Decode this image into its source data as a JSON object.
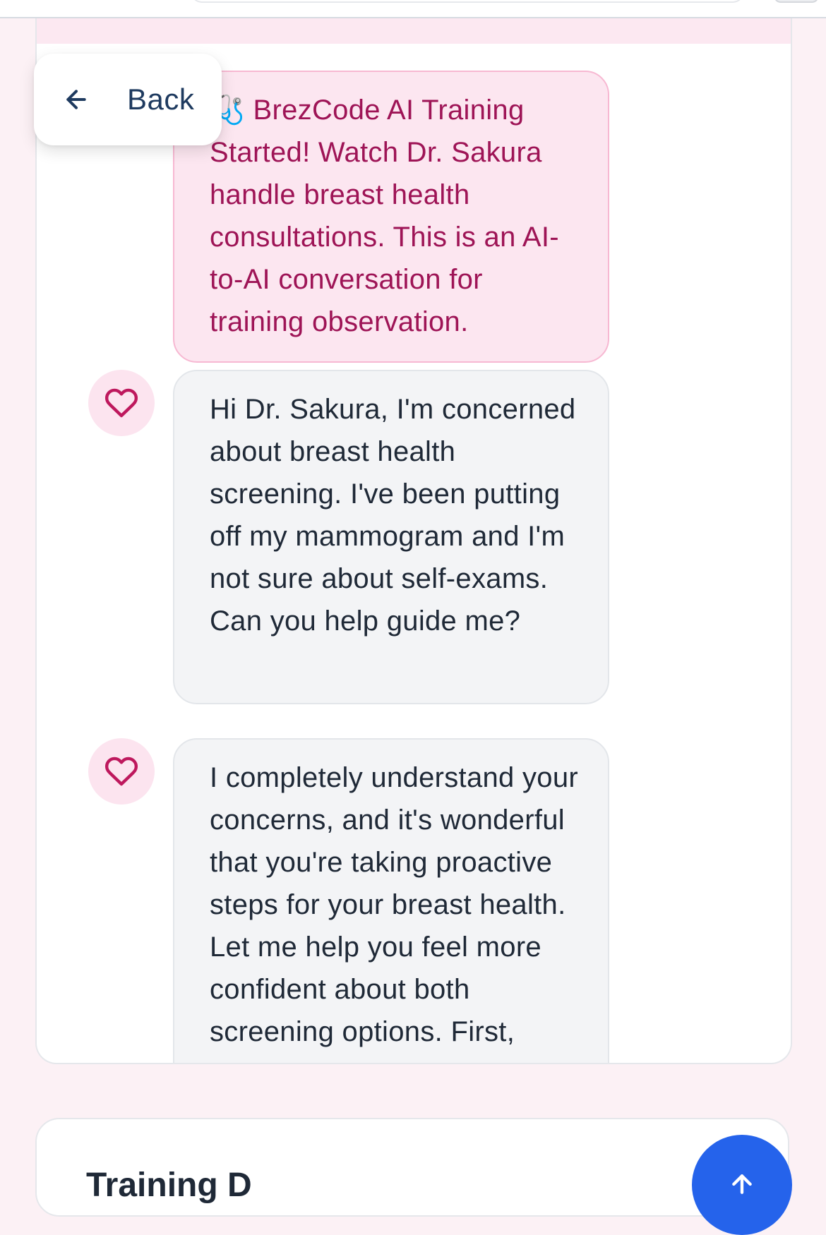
{
  "back_button": {
    "label": "Back",
    "icon": "arrow-left-icon"
  },
  "messages": [
    {
      "role": "system",
      "icon": "stethoscope-icon",
      "icon_glyph": "🩺",
      "text": "BrezCode AI Training Started! Watch Dr. Sakura handle breast health consultations. This is an AI-to-AI conversation for training observation."
    },
    {
      "role": "patient",
      "icon": "heart-icon",
      "text": "Hi Dr. Sakura, I'm concerned about breast health screening. I've been putting off my mammogram and I'm not sure about self-exams. Can you help guide me?"
    },
    {
      "role": "doctor",
      "icon": "heart-icon",
      "text": "I completely understand your concerns, and it's wonderful that you're taking proactive steps for your breast health. Let me help you feel more confident about both screening options. First, regarding mammograms"
    }
  ],
  "training_panel": {
    "title": "Training D"
  },
  "fab": {
    "icon": "arrow-up-icon"
  },
  "colors": {
    "page_bg": "#fcf1f5",
    "system_bubble_bg": "#fce6f0",
    "system_text": "#9e1456",
    "ai_bubble_bg": "#f3f4f6",
    "heart": "#be185d",
    "fab": "#2563eb"
  }
}
